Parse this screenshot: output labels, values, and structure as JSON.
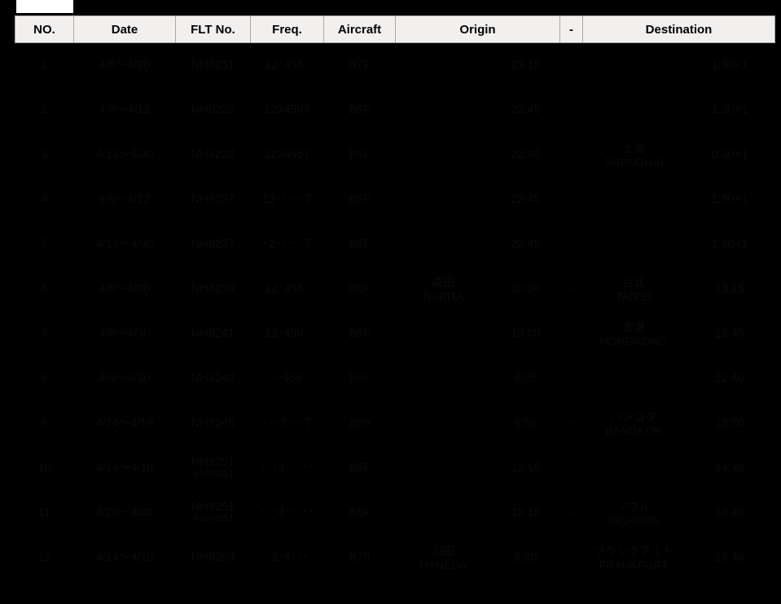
{
  "table": {
    "headers": {
      "no": "NO.",
      "date": "Date",
      "flt": "FLT No.",
      "freq": "Freq.",
      "aircraft": "Aircraft",
      "origin": "Origin",
      "arrow": "-",
      "destination": "Destination"
    },
    "rows": [
      {
        "no": "1",
        "date": "4/6～4/30",
        "date_highlight": true,
        "flt": "NH8231",
        "flt_note": "",
        "freq": "12･456･",
        "aircraft": "B7F",
        "aircraft_highlight": true,
        "origin_jp": "",
        "origin_en": "",
        "origin_time": "23:15",
        "arrow": "-",
        "dest_jp": "",
        "dest_en": "",
        "dest_time": "1:30+1"
      },
      {
        "no": "2",
        "date": "4/6～4/12",
        "date_highlight": false,
        "flt": "NH8233",
        "flt_note": "",
        "freq": "1234567",
        "aircraft": "B6F",
        "aircraft_highlight": false,
        "origin_jp": "",
        "origin_en": "",
        "origin_time": "22:45",
        "arrow": "-",
        "dest_jp": "",
        "dest_en": "",
        "dest_time": "1:30+1"
      },
      {
        "no": "3",
        "date": "4/13～4/30",
        "date_highlight": true,
        "flt": "NH8233",
        "flt_note": "",
        "freq": "1234567",
        "aircraft": "B6F",
        "aircraft_highlight": false,
        "origin_jp": "",
        "origin_en": "",
        "origin_time": "22:45",
        "arrow": "-",
        "dest_jp": "上海",
        "dest_en": "SHANGHAI",
        "dest_time": "0:30+1"
      },
      {
        "no": "4",
        "date": "4/6～4/12",
        "date_highlight": false,
        "flt": "NH8237",
        "flt_note": "",
        "freq": "12･････7",
        "aircraft": "B6F",
        "aircraft_highlight": false,
        "origin_jp": "",
        "origin_en": "",
        "origin_time": "22:45",
        "arrow": "-",
        "dest_jp": "",
        "dest_en": "",
        "dest_time": "1:30+1"
      },
      {
        "no": "5",
        "date": "4/13～4/30",
        "date_highlight": true,
        "flt": "NH8237",
        "flt_note": "",
        "freq": "･2･････7",
        "aircraft": "B6F",
        "aircraft_highlight": false,
        "origin_jp": "",
        "origin_en": "",
        "origin_time": "22:45",
        "arrow": "-",
        "dest_jp": "",
        "dest_en": "",
        "dest_time": "1:30+1"
      },
      {
        "no": "6",
        "date": "4/6～4/30",
        "date_highlight": true,
        "flt": "NH8239",
        "flt_note": "",
        "freq": "12･456･",
        "aircraft": "B6F",
        "aircraft_highlight": false,
        "origin_jp": "成田",
        "origin_en": "NARITA",
        "origin_time": "10:30",
        "arrow": "-",
        "dest_jp": "台北",
        "dest_en": "TAIPEI",
        "dest_time": "13:15"
      },
      {
        "no": "7",
        "date": "4/6～4/30",
        "date_highlight": true,
        "flt": "NH8241",
        "flt_note": "",
        "freq": "12･456･",
        "aircraft": "B6F",
        "aircraft_highlight": false,
        "origin_jp": "",
        "origin_en": "",
        "origin_time": "10:00",
        "arrow": "-",
        "dest_jp": "香港",
        "dest_en": "HONGKONG",
        "dest_time": "13:45"
      },
      {
        "no": "8",
        "date": "4/6～4/30",
        "date_highlight": true,
        "flt": "NH8243",
        "flt_note": "",
        "freq": "･･･456･",
        "aircraft": "B6F",
        "aircraft_highlight": false,
        "origin_jp": "",
        "origin_en": "",
        "origin_time": "8:05",
        "arrow": "-",
        "dest_jp": "",
        "dest_en": "",
        "dest_time": "12:40"
      },
      {
        "no": "9",
        "date": "4/14～4/19",
        "date_highlight": false,
        "flt": "NH8245",
        "flt_note": "",
        "freq": "･･･3･･･7",
        "aircraft": "B89",
        "aircraft_highlight": false,
        "origin_jp": "",
        "origin_en": "",
        "origin_time": "8:55",
        "arrow": "-",
        "dest_jp": "バンコク",
        "dest_en": "BANGKOK",
        "dest_time": "13:30"
      },
      {
        "no": "10",
        "date": "4/14～4/19",
        "date_highlight": false,
        "flt": "NH8251",
        "flt_note": "※NH8251",
        "freq": "･･･3･････",
        "aircraft": "B6F",
        "aircraft_highlight": false,
        "origin_jp": "",
        "origin_en": "",
        "origin_time": "12:15",
        "arrow": "-",
        "dest_jp": "",
        "dest_en": "",
        "dest_time": "14:40"
      },
      {
        "no": "11",
        "date": "4/20～4/30",
        "date_highlight": false,
        "flt": "NH8251",
        "flt_note": "※NH8251",
        "freq": "･･･4･････",
        "aircraft": "B6F",
        "aircraft_highlight": false,
        "origin_jp": "",
        "origin_en": "",
        "origin_time": "12:15",
        "arrow": "-",
        "dest_jp": "ソウル",
        "dest_en": "INCHEON",
        "dest_time": "14:40"
      },
      {
        "no": "12",
        "date": "4/14～4/16",
        "date_highlight": false,
        "flt": "NH8293",
        "flt_note": "",
        "freq": "･2･4･･･",
        "aircraft": "B79",
        "aircraft_highlight": false,
        "origin_jp": "羽田",
        "origin_en": "HANEDA",
        "origin_time": "8:30",
        "arrow": "-",
        "dest_jp": "フランクフルト",
        "dest_en": "FRANKFURT",
        "dest_time": "13:40"
      }
    ]
  },
  "colors": {
    "background": "#000000",
    "header_bg": "#f2f0ee",
    "highlight_date": "#ff0000",
    "highlight_cell": "#dce9f5",
    "text": "#0b0b0b"
  }
}
